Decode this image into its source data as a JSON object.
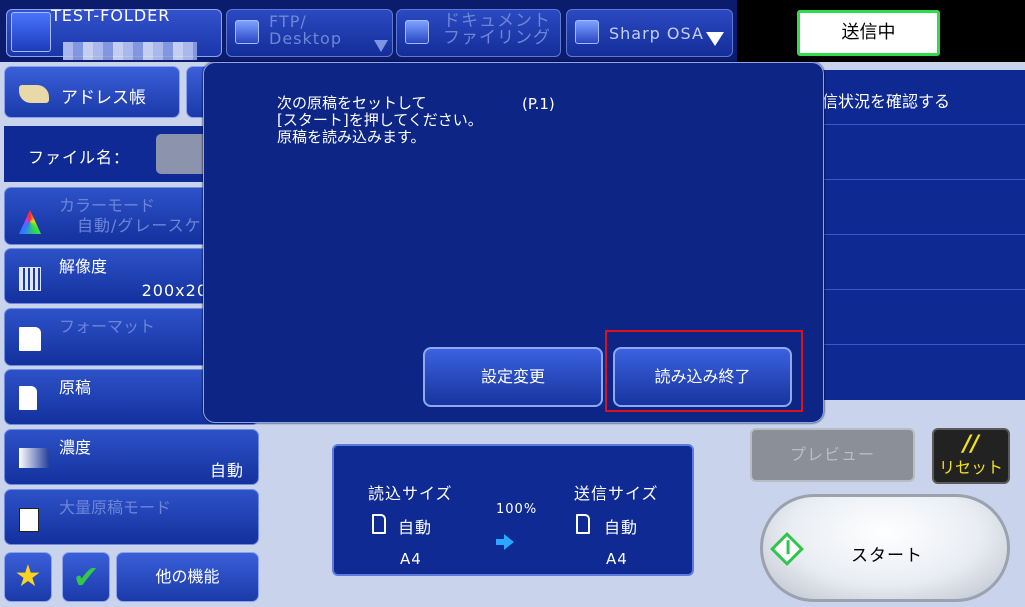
{
  "top_tabs": [
    {
      "label": "TEST-FOLDER",
      "icon": "network-folder-icon"
    },
    {
      "label": "FTP/\nDesktop",
      "icon": "ftp-desktop-icon"
    },
    {
      "label": "ドキュメント\nファイリング",
      "icon": "document-filing-icon"
    },
    {
      "label": "Sharp OSA",
      "icon": "sharp-osa-icon"
    }
  ],
  "status": {
    "label": "送信中",
    "border_color": "#2fdc4a"
  },
  "left": {
    "address_book": "アドレス帳",
    "file_name_label": "ファイル名：",
    "settings": [
      {
        "label": "カラーモード",
        "value": "自動/グレースケ",
        "icon": "color-mode-icon",
        "enabled": false
      },
      {
        "label": "解像度",
        "value": "200x20",
        "icon": "resolution-icon",
        "enabled": true
      },
      {
        "label": "フォーマット",
        "value": "",
        "icon": "file-format-icon",
        "enabled": false
      },
      {
        "label": "原稿",
        "value": "",
        "icon": "original-icon",
        "enabled": true
      },
      {
        "label": "濃度",
        "value": "自動",
        "icon": "exposure-icon",
        "enabled": true
      },
      {
        "label": "大量原稿モード",
        "value": "",
        "icon": "job-build-icon",
        "enabled": false
      }
    ],
    "other_functions": "他の機能"
  },
  "right": {
    "check_status_link": "信状況を確認する",
    "preview": "プレビュー",
    "reset_symbol": "//",
    "reset": "リセット",
    "start": "スタート"
  },
  "size_panel": {
    "scan_size_label": "読込サイズ",
    "scan_mode": "自動",
    "scan_paper": "A4",
    "ratio": "100%",
    "send_size_label": "送信サイズ",
    "send_mode": "自動",
    "send_paper": "A4"
  },
  "modal": {
    "message": "次の原稿をセットして\n[スタート]を押してください。\n原稿を読み込みます。",
    "page": "(P.1)",
    "change_settings": "設定変更",
    "finish_reading": "読み込み終了",
    "highlight_color": "#e0101a"
  }
}
